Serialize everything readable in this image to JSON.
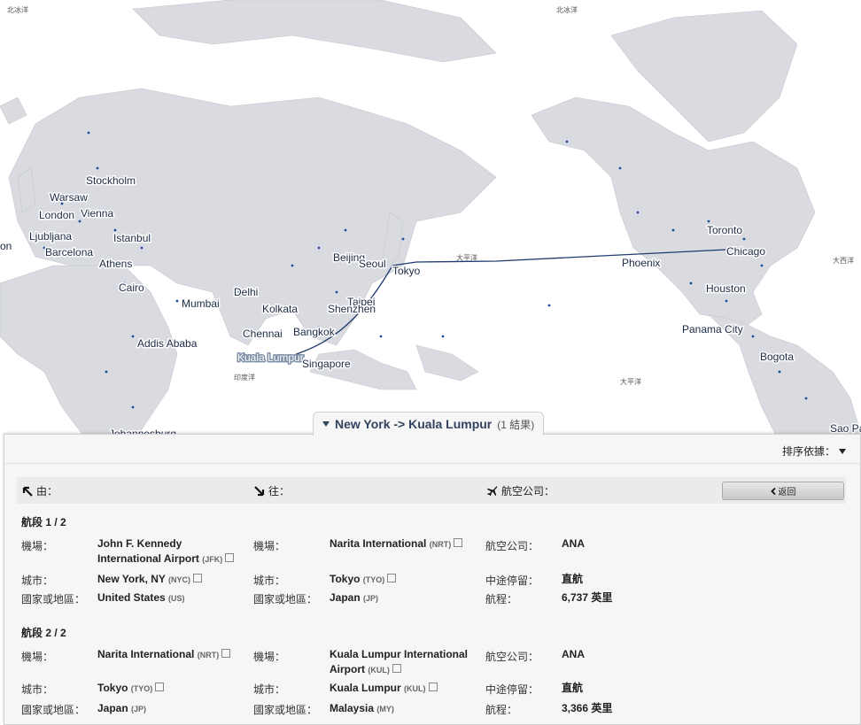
{
  "map": {
    "cities": [
      "Stockholm",
      "Warsaw",
      "London",
      "Vienna",
      "Ljubljana",
      "Istanbul",
      "Barcelona",
      "Athens",
      "Cairo",
      "Mumbai",
      "Addis Ababa",
      "Delhi",
      "Kolkata",
      "Chennai",
      "Bangkok",
      "Kuala Lumpur",
      "Singapore",
      "Beijing",
      "Seoul",
      "Tokyo",
      "Taipei",
      "Shenzhen",
      "Phoenix",
      "Toronto",
      "Chicago",
      "Houston",
      "Panama City",
      "Bogota",
      "Sao Pa",
      "Johannesburg",
      "on"
    ],
    "oceans": [
      "北冰洋",
      "北冰洋",
      "大平洋",
      "大平洋",
      "印度洋",
      "大西洋"
    ]
  },
  "panel": {
    "route_title": "New York -> Kuala Lumpur",
    "result_count": "(1 結果)",
    "sort_label": "排序依據："
  },
  "header": {
    "from_label": "由：",
    "to_label": "往：",
    "airline_label": "航空公司：",
    "back_label": "返回"
  },
  "segments": [
    {
      "title": "航段 1 / 2",
      "from": {
        "airport_label": "機場：",
        "airport": "John F. Kennedy International Airport",
        "airport_code": "(JFK)",
        "city_label": "城市：",
        "city": "New York, NY",
        "city_code": "(NYC)",
        "country_label": "國家或地區：",
        "country": "United States",
        "country_code": "(US)"
      },
      "to": {
        "airport_label": "機場：",
        "airport": "Narita International",
        "airport_code": "(NRT)",
        "city_label": "城市：",
        "city": "Tokyo",
        "city_code": "(TYO)",
        "country_label": "國家或地區：",
        "country": "Japan",
        "country_code": "(JP)"
      },
      "info": {
        "airline_label": "航空公司：",
        "airline": "ANA",
        "stops_label": "中途停留：",
        "stops": "直航",
        "distance_label": "航程：",
        "distance": "6,737 英里"
      }
    },
    {
      "title": "航段 2 / 2",
      "from": {
        "airport_label": "機場：",
        "airport": "Narita International",
        "airport_code": "(NRT)",
        "city_label": "城市：",
        "city": "Tokyo",
        "city_code": "(TYO)",
        "country_label": "國家或地區：",
        "country": "Japan",
        "country_code": "(JP)"
      },
      "to": {
        "airport_label": "機場：",
        "airport": "Kuala Lumpur International Airport",
        "airport_code": "(KUL)",
        "city_label": "城市：",
        "city": "Kuala Lumpur",
        "city_code": "(KUL)",
        "country_label": "國家或地區：",
        "country": "Malaysia",
        "country_code": "(MY)"
      },
      "info": {
        "airline_label": "航空公司：",
        "airline": "ANA",
        "stops_label": "中途停留：",
        "stops": "直航",
        "distance_label": "航程：",
        "distance": "3,366 英里"
      }
    }
  ]
}
